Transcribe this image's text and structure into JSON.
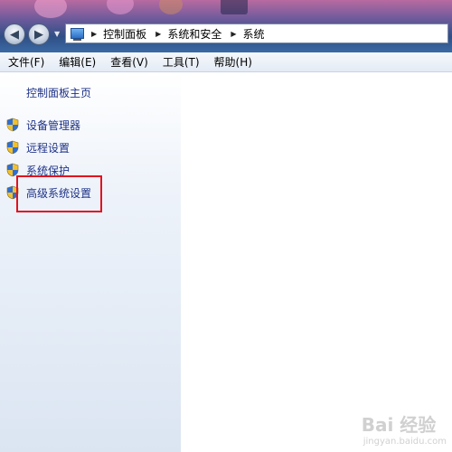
{
  "breadcrumb": [
    "控制面板",
    "系统和安全",
    "系统"
  ],
  "menu": [
    "文件(F)",
    "编辑(E)",
    "查看(V)",
    "工具(T)",
    "帮助(H)"
  ],
  "sidebar": {
    "home_link": "控制面板主页",
    "items": [
      {
        "label": "设备管理器",
        "icon": "shield-icon"
      },
      {
        "label": "远程设置",
        "icon": "shield-icon"
      },
      {
        "label": "系统保护",
        "icon": "shield-icon"
      },
      {
        "label": "高级系统设置",
        "icon": "shield-icon"
      }
    ]
  },
  "watermark": {
    "main": "Bai 经验",
    "sub": "jingyan.baidu.com"
  },
  "colors": {
    "link": "#1e3287",
    "highlight_border": "#e0131f",
    "pane_bg": "#dbe5f2"
  }
}
